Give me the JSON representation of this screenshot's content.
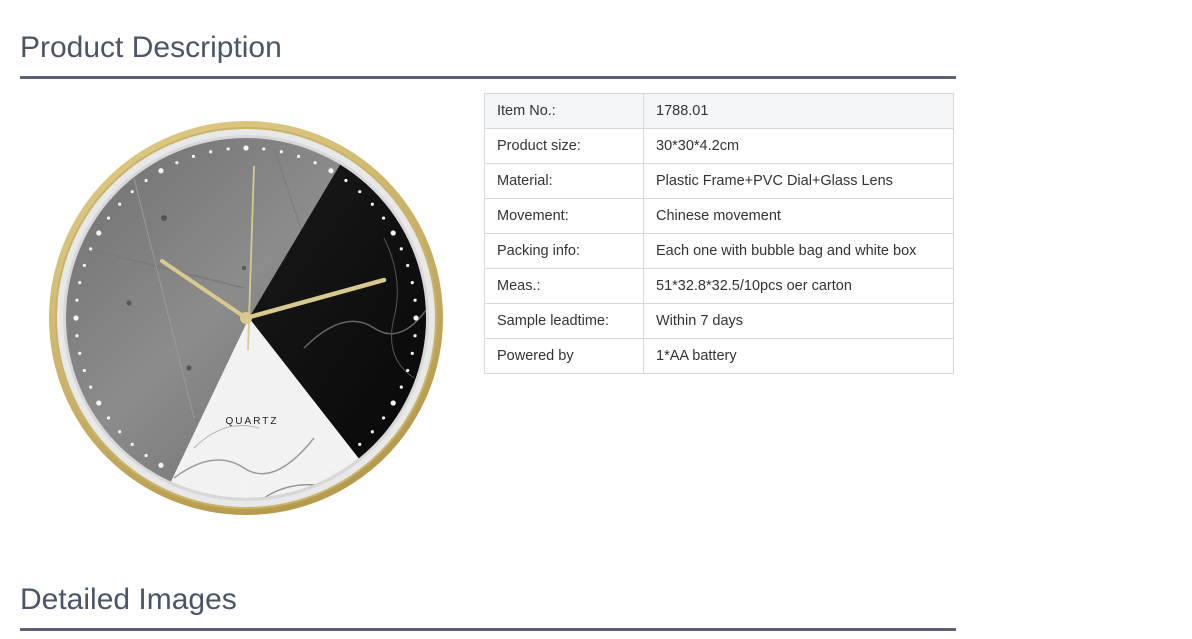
{
  "sections": {
    "product_description": "Product Description",
    "detailed_images": "Detailed Images"
  },
  "clock_image": {
    "dial_text": "QUARTZ",
    "frame_color": "#d9c27a",
    "hand_color": "#d8c98c"
  },
  "specs": [
    {
      "label": "Item No.:",
      "value": "1788.01"
    },
    {
      "label": "Product size:",
      "value": "30*30*4.2cm"
    },
    {
      "label": "Material:",
      "value": "Plastic Frame+PVC Dial+Glass Lens"
    },
    {
      "label": "Movement:",
      "value": "Chinese movement"
    },
    {
      "label": "Packing info:",
      "value": "Each one with bubble bag and white box"
    },
    {
      "label": "Meas.:",
      "value": "51*32.8*32.5/10pcs oer carton"
    },
    {
      "label": "Sample leadtime:",
      "value": "Within 7 days"
    },
    {
      "label": "Powered by",
      "value": "1*AA battery"
    }
  ]
}
